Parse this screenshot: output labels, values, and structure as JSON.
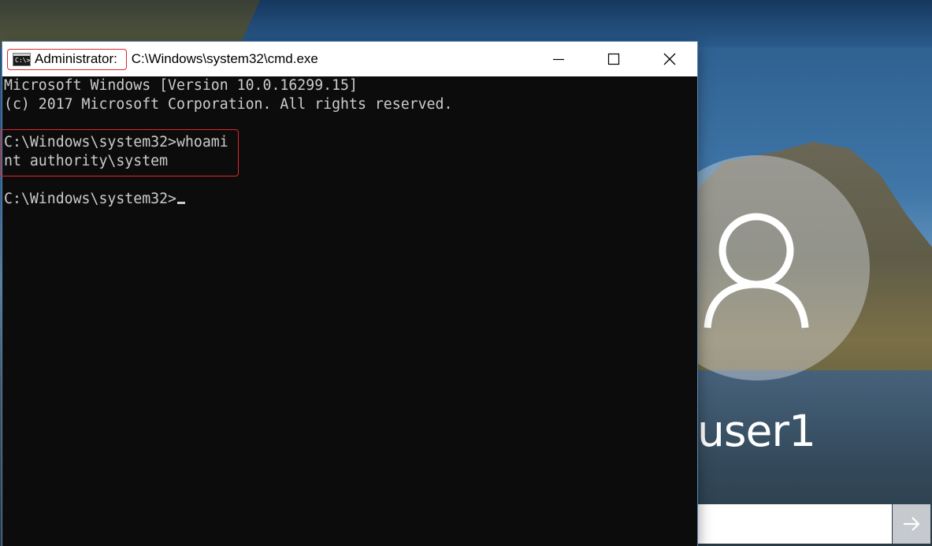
{
  "lock_screen": {
    "username": "user1",
    "password_placeholder": "",
    "avatar_icon": "user-silhouette-icon",
    "submit_icon": "arrow-right-icon"
  },
  "cmd": {
    "title_prefix": "Administrator:",
    "title_path": " C:\\Windows\\system32\\cmd.exe",
    "app_icon": "cmd-icon",
    "app_icon_text": "C:\\>_",
    "controls": {
      "minimize_icon": "minimize-icon",
      "maximize_icon": "maximize-icon",
      "close_icon": "close-icon"
    },
    "lines": [
      "Microsoft Windows [Version 10.0.16299.15]",
      "(c) 2017 Microsoft Corporation. All rights reserved.",
      "",
      "C:\\Windows\\system32>whoami",
      "nt authority\\system",
      "",
      "C:\\Windows\\system32>"
    ]
  },
  "colors": {
    "console_bg": "#0c0c0c",
    "console_text": "#cccccc",
    "highlight_border": "#e0262e",
    "titlebar_bg": "#ffffff"
  }
}
